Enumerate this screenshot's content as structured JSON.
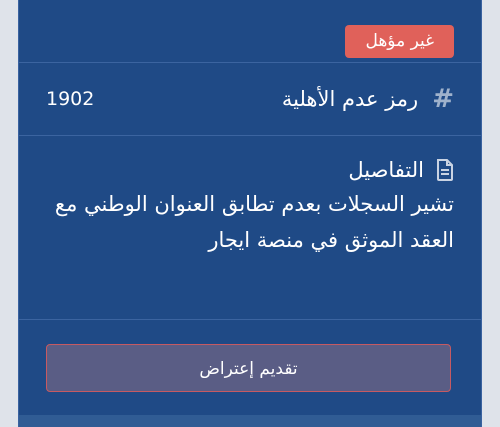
{
  "status": {
    "badge": "غير مؤهل"
  },
  "ineligibility_code": {
    "icon": "hash-icon",
    "label": "رمز عدم الأهلية",
    "value": "1902"
  },
  "details": {
    "icon": "document-icon",
    "title": "التفاصيل",
    "text": "تشير السجلات بعدم تطابق العنوان الوطني مع العقد الموثق في منصة ايجار"
  },
  "actions": {
    "objection_label": "تقديم إعتراض"
  },
  "colors": {
    "card": "#1f4a86",
    "badge": "#e0615a",
    "button": "#5a5d85",
    "button_border": "#c65a62"
  }
}
